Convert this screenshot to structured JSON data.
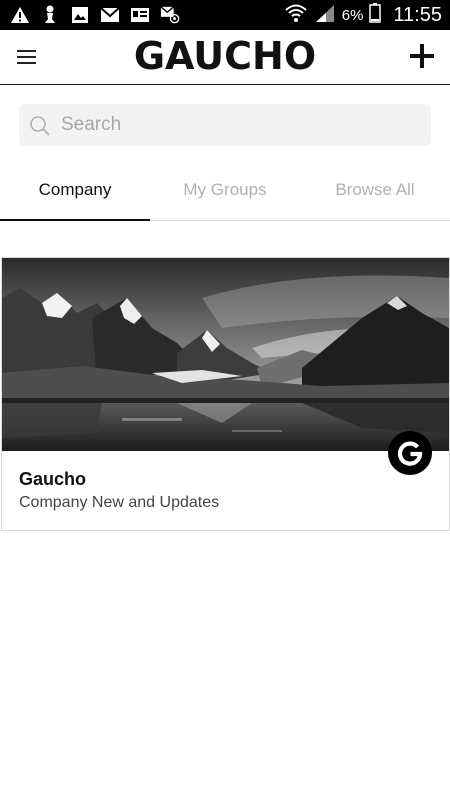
{
  "status_bar": {
    "battery_percent": "6%",
    "time": "11:55",
    "notification_icons": [
      "warning-icon",
      "chess-pawn-icon",
      "image-icon",
      "gmail-icon",
      "id-card-icon",
      "email-at-icon"
    ],
    "system_icons": [
      "wifi-icon",
      "signal-icon",
      "battery-icon"
    ]
  },
  "app_bar": {
    "title": "GAUCHO",
    "menu_icon": "hamburger-menu-icon",
    "add_icon": "plus-icon"
  },
  "search": {
    "placeholder": "Search",
    "value": ""
  },
  "tabs": [
    {
      "label": "Company",
      "active": true
    },
    {
      "label": "My Groups",
      "active": false
    },
    {
      "label": "Browse All",
      "active": false
    }
  ],
  "cards": [
    {
      "title": "Gaucho",
      "subtitle": "Company New and Updates",
      "image": "mountain-lake-photo",
      "badge_letter": "G"
    }
  ],
  "colors": {
    "status_bar": "#000000",
    "accent": "#111111",
    "inactive_tab": "#b0b0b0",
    "search_bg": "#f3f3f3"
  }
}
